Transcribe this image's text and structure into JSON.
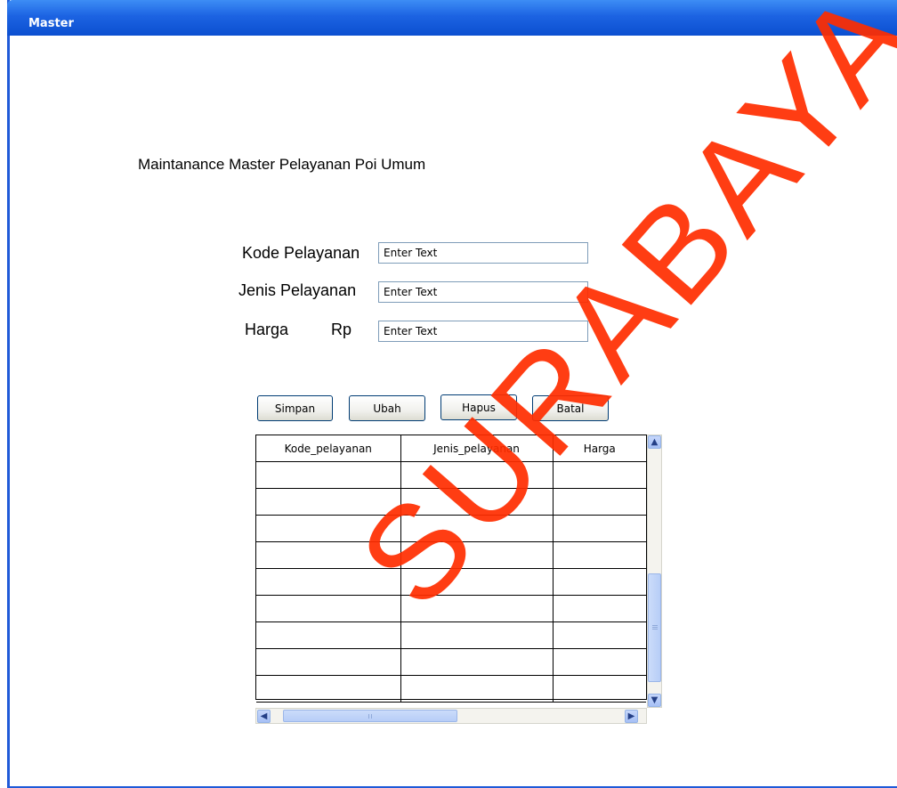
{
  "window": {
    "title": "Master"
  },
  "form": {
    "heading": "Maintanance Master Pelayanan Poi Umum",
    "fields": [
      {
        "label": "Kode Pelayanan",
        "value": "Enter Text"
      },
      {
        "label": "Jenis Pelayanan",
        "value": "Enter Text"
      },
      {
        "label": "Harga",
        "unit": "Rp",
        "value": "Enter Text"
      }
    ]
  },
  "buttons": {
    "save": "Simpan",
    "edit": "Ubah",
    "delete": "Hapus",
    "cancel": "Batal"
  },
  "grid": {
    "columns": [
      "Kode_pelayanan",
      "Jenis_pelayanan",
      "Harga"
    ],
    "empty_rows": 9
  },
  "scrollbars": {
    "up": "arrow-up-icon",
    "down": "arrow-down-icon",
    "left": "arrow-left-icon",
    "right": "arrow-right-icon"
  },
  "watermark": {
    "text": "SURABAYA",
    "color": "#ff2d00"
  },
  "colors": {
    "titlebar": "#1c63e2",
    "frame": "#1f5ad8"
  }
}
